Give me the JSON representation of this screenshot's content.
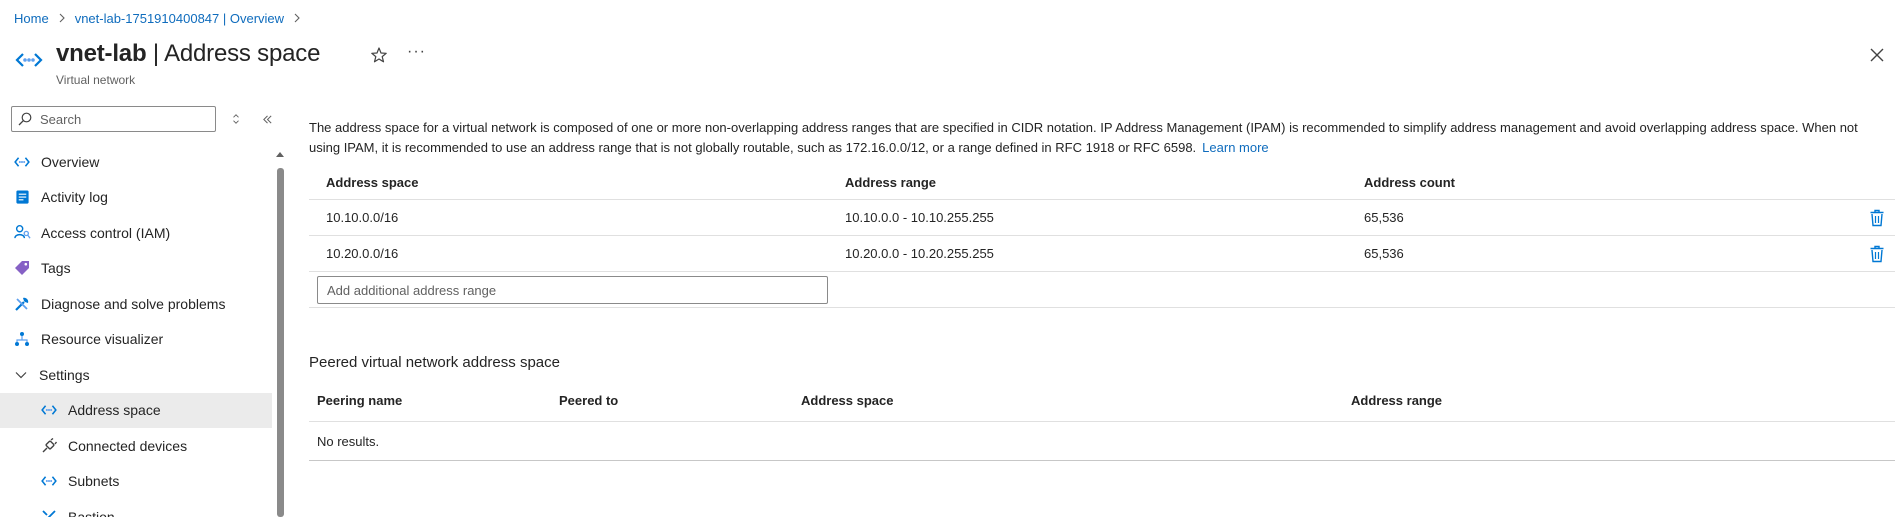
{
  "breadcrumb": {
    "home": "Home",
    "resource": "vnet-lab-1751910400847 | Overview"
  },
  "header": {
    "title_name": "vnet-lab",
    "title_section": " | Address space",
    "subtitle": "Virtual network",
    "more_label": "···"
  },
  "sidebar": {
    "search_placeholder": "Search",
    "items": [
      {
        "label": "Overview",
        "icon": "vnet-icon"
      },
      {
        "label": "Activity log",
        "icon": "activity-log-icon"
      },
      {
        "label": "Access control (IAM)",
        "icon": "iam-icon"
      },
      {
        "label": "Tags",
        "icon": "tag-icon"
      },
      {
        "label": "Diagnose and solve problems",
        "icon": "diagnose-icon"
      },
      {
        "label": "Resource visualizer",
        "icon": "visualizer-icon"
      },
      {
        "label": "Settings",
        "icon": "chevron-down-icon"
      },
      {
        "label": "Address space",
        "icon": "vnet-icon"
      },
      {
        "label": "Connected devices",
        "icon": "plug-icon"
      },
      {
        "label": "Subnets",
        "icon": "vnet-icon"
      },
      {
        "label": "Bastion",
        "icon": "bastion-icon"
      }
    ]
  },
  "main": {
    "description": "The address space for a virtual network is composed of one or more non-overlapping address ranges that are specified in CIDR notation. IP Address Management (IPAM) is recommended to simplify address management and avoid overlapping address space. When not using IPAM, it is recommended to use an address range that is not globally routable, such as 172.16.0.0/12, or a range defined in RFC 1918 or RFC 6598.",
    "learn_more": "Learn more",
    "address_table": {
      "columns": [
        "Address space",
        "Address range",
        "Address count"
      ],
      "rows": [
        {
          "space": "10.10.0.0/16",
          "range": "10.10.0.0 - 10.10.255.255",
          "count": "65,536"
        },
        {
          "space": "10.20.0.0/16",
          "range": "10.20.0.0 - 10.20.255.255",
          "count": "65,536"
        }
      ],
      "add_placeholder": "Add additional address range"
    },
    "peered": {
      "title": "Peered virtual network address space",
      "columns": [
        "Peering name",
        "Peered to",
        "Address space",
        "Address range"
      ],
      "empty_text": "No results."
    }
  },
  "colors": {
    "link": "#0f6cbd",
    "active_nav_bg": "#ebebeb",
    "azure_blue": "#0078d4"
  }
}
